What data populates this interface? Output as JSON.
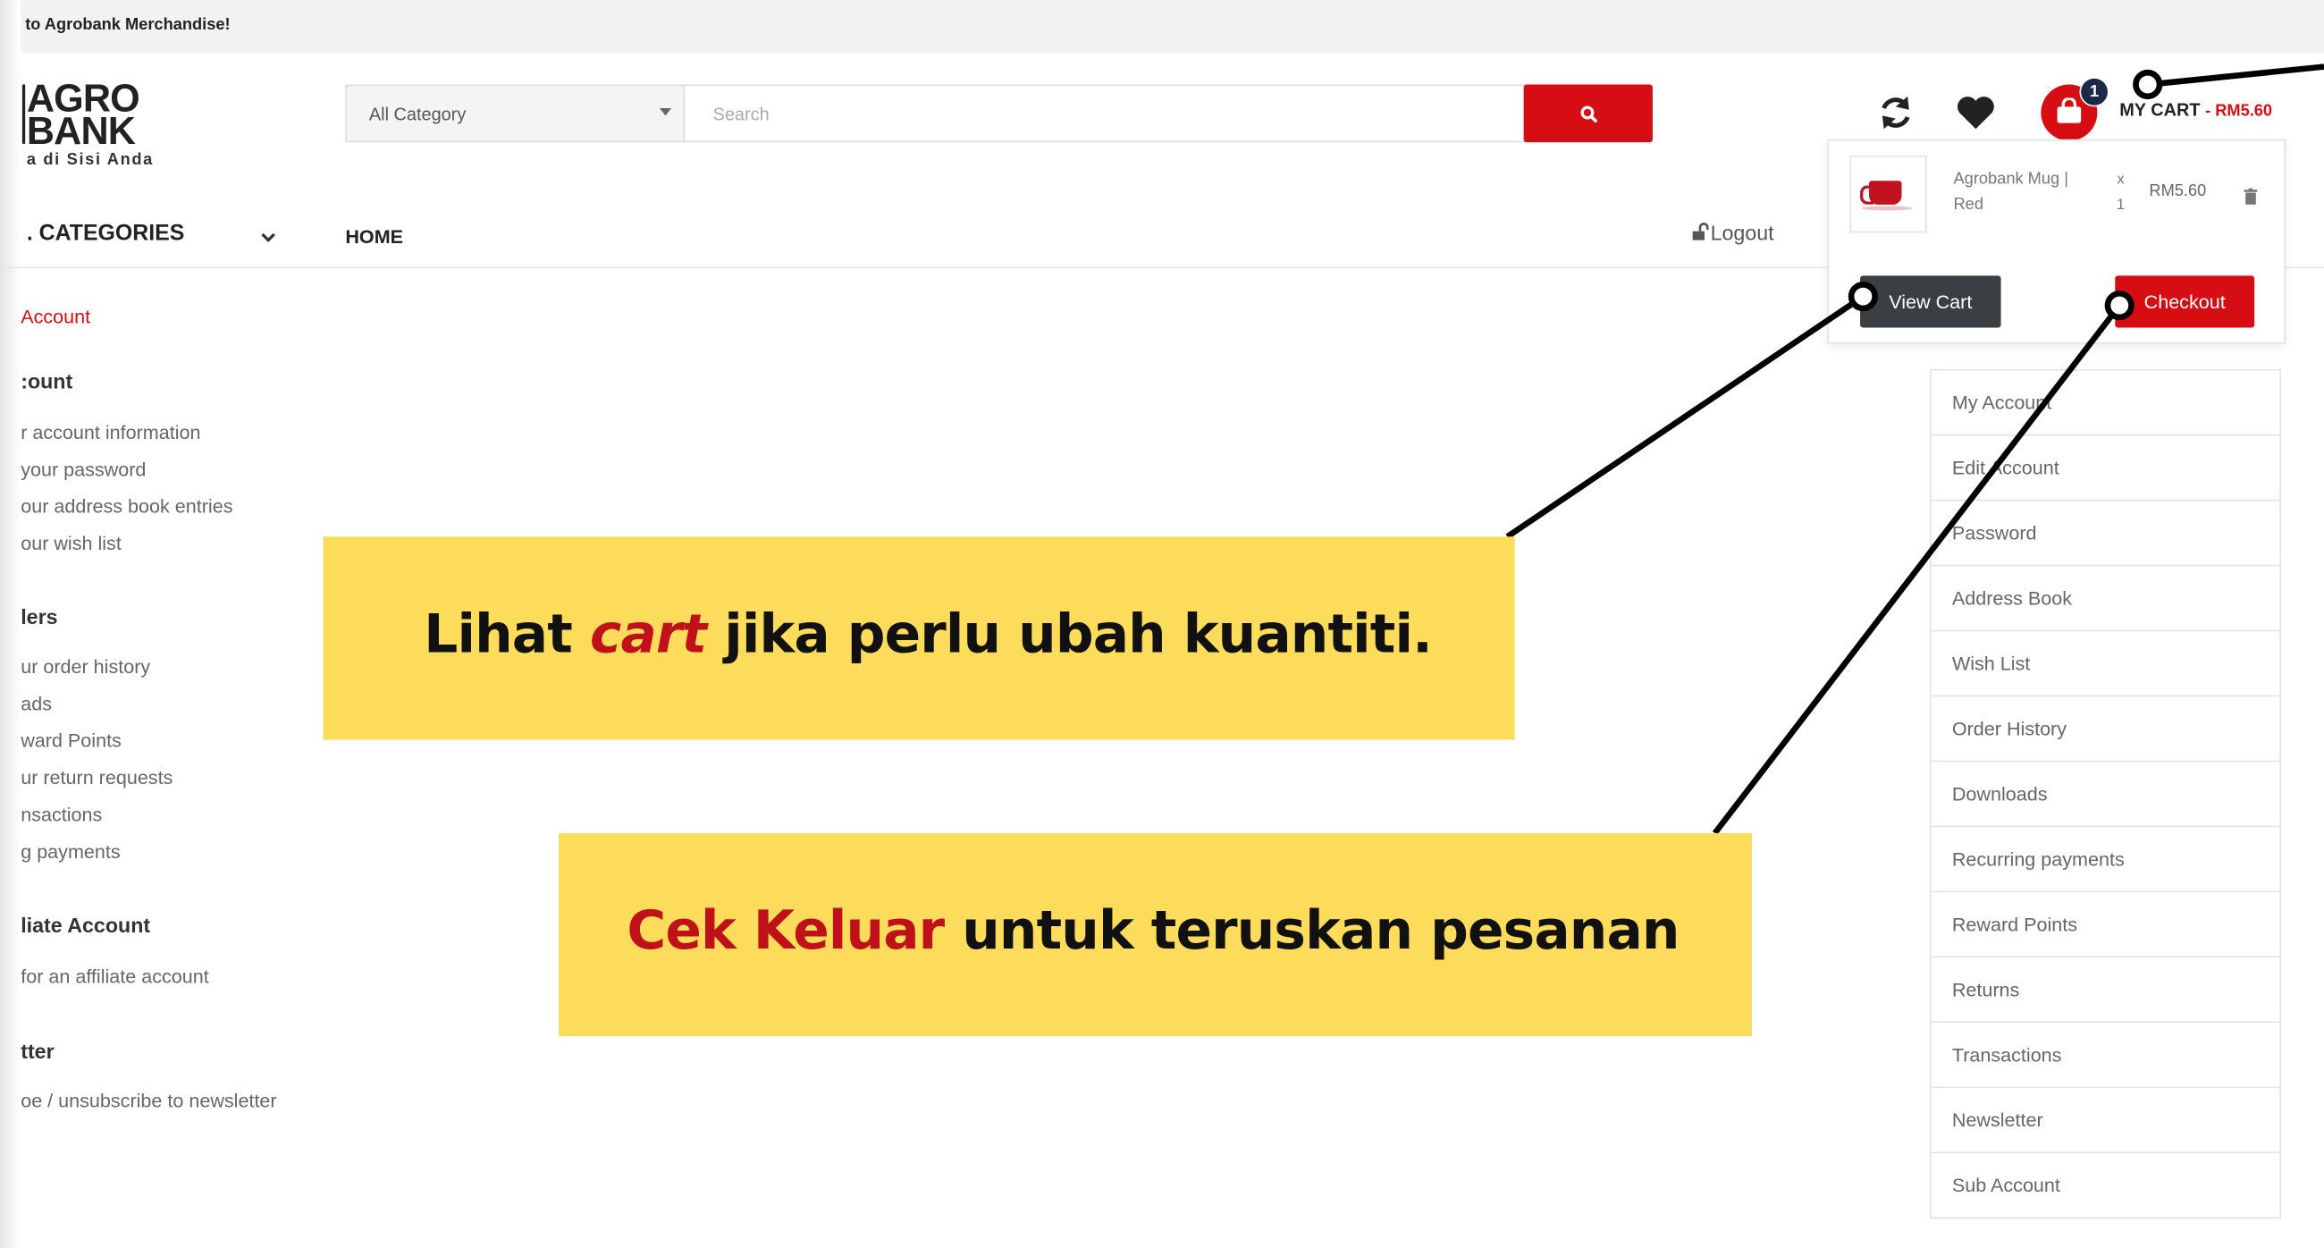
{
  "topbar": {
    "text": "to Agrobank Merchandise!"
  },
  "logo": {
    "line1": "AGRO",
    "line2": "BANK",
    "tagline": "a di Sisi Anda"
  },
  "search": {
    "category": "All Category",
    "placeholder": "Search"
  },
  "header": {
    "cart_count": "1",
    "my_cart": "MY CART",
    "cart_total": "- RM5.60"
  },
  "nav": {
    "categories": ". CATEGORIES",
    "home": "HOME",
    "logout": "Logout"
  },
  "sidebar": {
    "account_link": "Account",
    "sections": [
      {
        "title": ":ount",
        "items": [
          "r account information",
          "your password",
          "our address book entries",
          "our wish list"
        ]
      },
      {
        "title": "lers",
        "items": [
          "ur order history",
          "ads",
          "ward Points",
          "ur return requests",
          "nsactions",
          "g payments"
        ]
      },
      {
        "title": "liate Account",
        "items": [
          "for an affiliate account"
        ]
      },
      {
        "title": "tter",
        "items": [
          "oe / unsubscribe to newsletter"
        ]
      }
    ]
  },
  "cart_dropdown": {
    "product_name": "Agrobank Mug | Red",
    "qty_x": "x",
    "qty": "1",
    "price": "RM5.60",
    "view_cart": "View Cart",
    "checkout": "Checkout"
  },
  "account_menu": [
    "My Account",
    "Edit Account",
    "Password",
    "Address Book",
    "Wish List",
    "Order History",
    "Downloads",
    "Recurring payments",
    "Reward Points",
    "Returns",
    "Transactions",
    "Newsletter",
    "Sub Account"
  ],
  "callouts": {
    "c1_a": "Lihat ",
    "c1_b": "cart",
    "c1_c": " jika perlu ubah kuantiti.",
    "c2_a": "Cek Keluar",
    "c2_b": " untuk teruskan pesanan"
  }
}
